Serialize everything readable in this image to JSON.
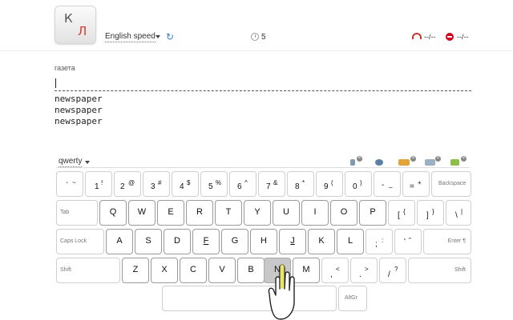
{
  "header": {
    "logo_k": "К",
    "logo_l": "Л",
    "lesson": "English speed",
    "timer": "5",
    "speed": "--/--",
    "errors": "--/--"
  },
  "exercise": {
    "word": "газета",
    "typed": [
      "newspaper",
      "newspaper",
      "newspaper"
    ]
  },
  "keyboard": {
    "layout": "qwerty",
    "row1": [
      {
        "lo": "`",
        "hi": "~"
      },
      {
        "lo": "1",
        "hi": "!"
      },
      {
        "lo": "2",
        "hi": "@"
      },
      {
        "lo": "3",
        "hi": "#"
      },
      {
        "lo": "4",
        "hi": "$"
      },
      {
        "lo": "5",
        "hi": "%"
      },
      {
        "lo": "6",
        "hi": "^"
      },
      {
        "lo": "7",
        "hi": "&"
      },
      {
        "lo": "8",
        "hi": "*"
      },
      {
        "lo": "9",
        "hi": "("
      },
      {
        "lo": "0",
        "hi": ")"
      },
      {
        "lo": "-",
        "hi": "_"
      },
      {
        "lo": "=",
        "hi": "+"
      }
    ],
    "backspace": "Backspace",
    "tab": "Tab",
    "row2": [
      "Q",
      "W",
      "E",
      "R",
      "T",
      "Y",
      "U",
      "I",
      "O",
      "P"
    ],
    "row2_sym": [
      {
        "lo": "[",
        "hi": "{"
      },
      {
        "lo": "]",
        "hi": "}"
      },
      {
        "lo": "\\",
        "hi": "|"
      }
    ],
    "capslock": "Caps Lock",
    "row3": [
      "A",
      "S",
      "D",
      "F",
      "G",
      "H",
      "J",
      "K",
      "L"
    ],
    "row3_sym": [
      {
        "lo": ";",
        "hi": ":"
      },
      {
        "lo": "'",
        "hi": "\""
      }
    ],
    "enter": "Enter ¶",
    "shift": "Shift",
    "row4": [
      "Z",
      "X",
      "C",
      "V",
      "B",
      "N",
      "M"
    ],
    "row4_sym": [
      {
        "lo": ",",
        "hi": "<"
      },
      {
        "lo": ".",
        "hi": ">"
      },
      {
        "lo": "/",
        "hi": "?"
      }
    ],
    "altgr": "AltGr",
    "highlighted_key": "N"
  },
  "icons": {
    "logo": "keyboard-logo-icon",
    "lesson_caret": "chevron-down-icon",
    "refresh": "refresh-icon",
    "timer": "clock-icon",
    "speed": "speedometer-icon",
    "errors": "error-icon",
    "tools": [
      "sound-icon",
      "color-icon",
      "hands-icon",
      "keyboard-icon",
      "highlight-icon"
    ]
  },
  "colors": {
    "accent": "#3b7fc4",
    "error": "#d0021b",
    "logo_red": "#d63b2a",
    "pressed_key": "#c8c8c8",
    "finger_highlight": "#e8e36a"
  }
}
